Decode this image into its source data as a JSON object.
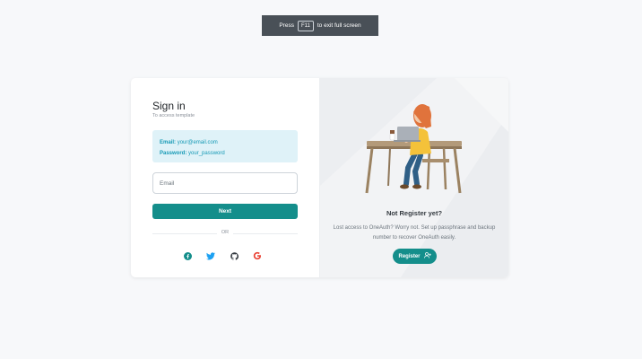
{
  "fullscreen_hint": {
    "pre": "Press",
    "key": "F11",
    "post": "to exit full screen"
  },
  "signin": {
    "title": "Sign in",
    "subtitle": "To access template",
    "demo": {
      "email_label": "Email:",
      "email_value": "your@email.com",
      "password_label": "Password:",
      "password_value": "your_password"
    },
    "email_placeholder": "Email",
    "next_label": "Next",
    "or_label": "OR",
    "socials": [
      "facebook-icon",
      "twitter-icon",
      "github-icon",
      "google-icon"
    ]
  },
  "register_panel": {
    "title": "Not Register yet?",
    "text": "Lost access to OneAuth? Worry not. Set up passphrase and backup number to recover OneAuth easily.",
    "button_label": "Register"
  },
  "colors": {
    "accent": "#148e8b",
    "info_bg": "#dff2f8",
    "info_text": "#1599b5",
    "facebook": "#148e8b",
    "twitter": "#1da1f2",
    "github": "#343a40",
    "google": "#ea4335"
  }
}
